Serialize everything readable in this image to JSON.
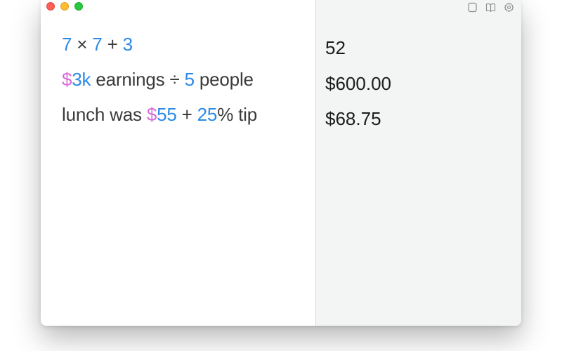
{
  "window": {
    "controls": [
      "close",
      "minimize",
      "zoom"
    ],
    "toolbar_icons": [
      "sidebar-icon",
      "book-icon",
      "gear-icon"
    ]
  },
  "editor": {
    "lines": [
      {
        "tokens": [
          {
            "text": "7",
            "kind": "number"
          },
          {
            "text": " × ",
            "kind": "operator"
          },
          {
            "text": "7",
            "kind": "number"
          },
          {
            "text": " + ",
            "kind": "operator"
          },
          {
            "text": "3",
            "kind": "number"
          }
        ]
      },
      {
        "tokens": [
          {
            "text": "$",
            "kind": "currency"
          },
          {
            "text": "3k",
            "kind": "number"
          },
          {
            "text": " earnings ÷ ",
            "kind": "text"
          },
          {
            "text": "5",
            "kind": "number"
          },
          {
            "text": " people",
            "kind": "text"
          }
        ]
      },
      {
        "tokens": [
          {
            "text": "lunch was ",
            "kind": "text"
          },
          {
            "text": "$",
            "kind": "currency"
          },
          {
            "text": "55",
            "kind": "number"
          },
          {
            "text": " + ",
            "kind": "operator"
          },
          {
            "text": "25",
            "kind": "number"
          },
          {
            "text": "% tip",
            "kind": "text"
          }
        ]
      }
    ]
  },
  "results": [
    "52",
    "$600.00",
    "$68.75"
  ],
  "colors": {
    "number": "#2b8ae6",
    "currency": "#d56ad6",
    "text": "#3a3a3a",
    "results_bg": "#f3f4f4"
  }
}
